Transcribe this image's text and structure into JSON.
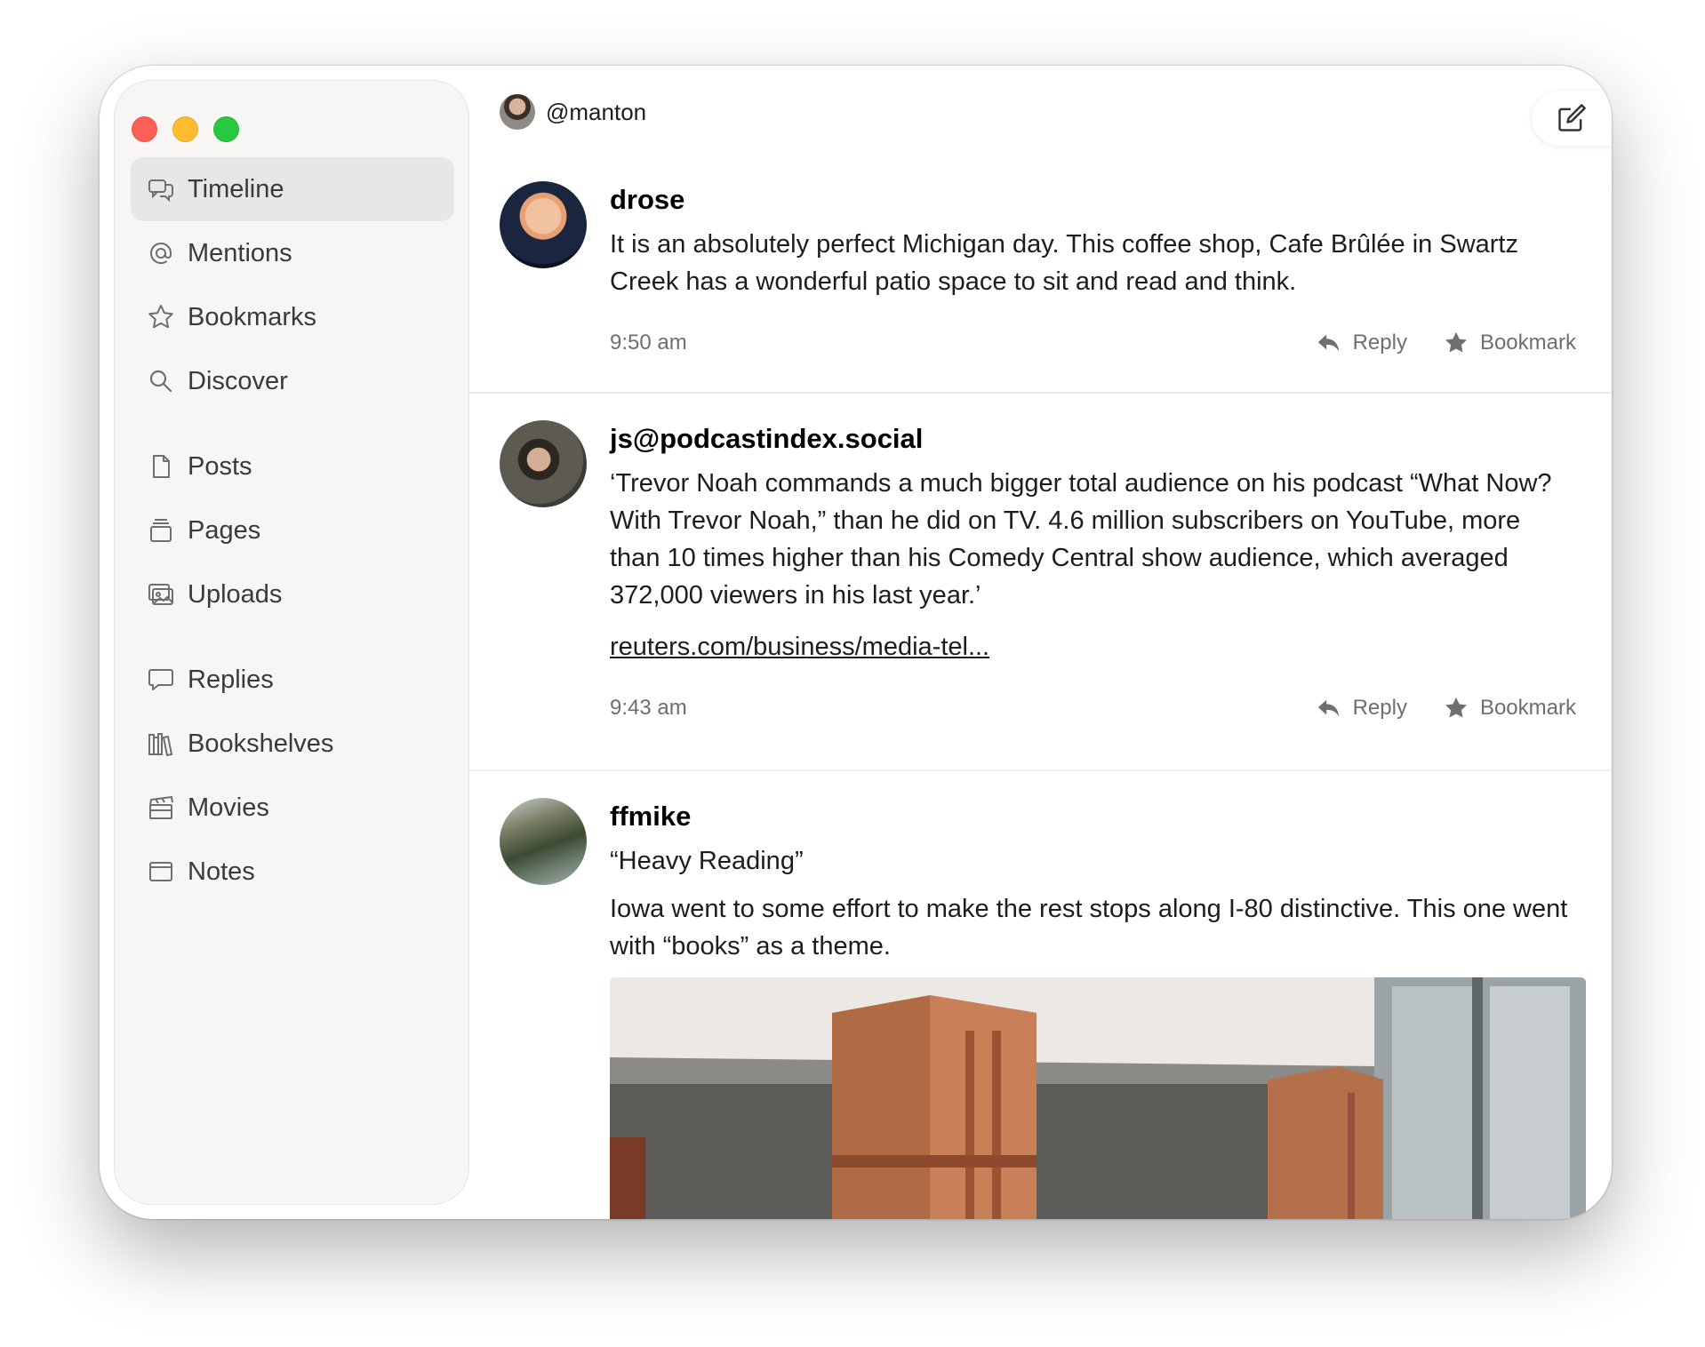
{
  "account": {
    "handle": "@manton"
  },
  "sidebar": {
    "items": [
      {
        "label": "Timeline",
        "icon": "timeline-icon",
        "active": true
      },
      {
        "label": "Mentions",
        "icon": "at-sign-icon"
      },
      {
        "label": "Bookmarks",
        "icon": "star-icon"
      },
      {
        "label": "Discover",
        "icon": "search-icon"
      },
      {
        "label": "Posts",
        "icon": "document-icon"
      },
      {
        "label": "Pages",
        "icon": "pages-stack-icon"
      },
      {
        "label": "Uploads",
        "icon": "photos-icon"
      },
      {
        "label": "Replies",
        "icon": "speech-bubble-icon"
      },
      {
        "label": "Bookshelves",
        "icon": "bookshelf-icon"
      },
      {
        "label": "Movies",
        "icon": "clapperboard-icon"
      },
      {
        "label": "Notes",
        "icon": "note-window-icon"
      }
    ]
  },
  "toolbar": {
    "compose_icon": "compose-icon"
  },
  "actions": {
    "reply_label": "Reply",
    "bookmark_label": "Bookmark"
  },
  "posts": [
    {
      "author": "drose",
      "text": "It is an absolutely perfect Michigan day. This coffee shop, Cafe Brûlée in Swartz Creek has a wonderful patio space to sit and read and think.",
      "time": "9:50 am"
    },
    {
      "author": "js@podcastindex.social",
      "text": "‘Trevor Noah commands a much bigger total audience on his podcast “What Now? With Trevor Noah,” than he did on TV. 4.6 million subscribers on YouTube, more than 10 times higher than his Comedy Central show audience, which averaged 372,000 viewers in his last year.’",
      "link": "reuters.com/business/media-tel...",
      "time": "9:43 am"
    },
    {
      "author": "ffmike",
      "title": "“Heavy Reading”",
      "text": "Iowa went to some effort to make the rest stops along I-80 distinctive. This one went with “books” as a theme."
    }
  ]
}
